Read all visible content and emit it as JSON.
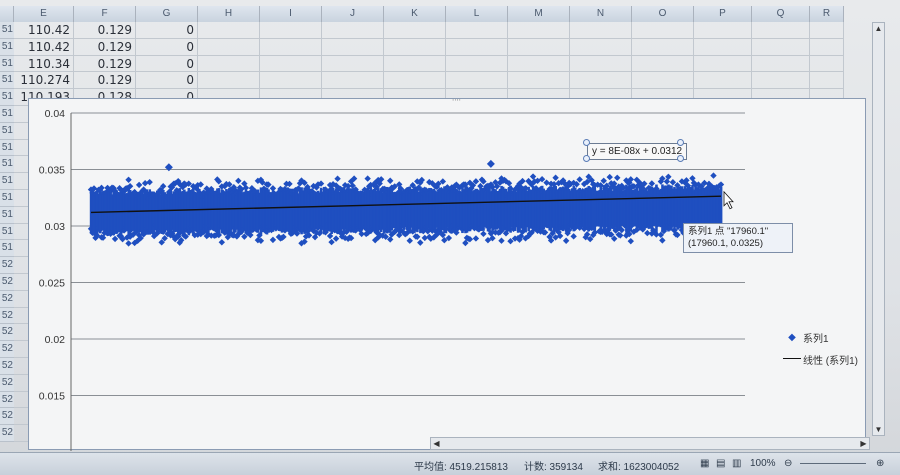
{
  "columns": [
    "E",
    "F",
    "G",
    "H",
    "I",
    "J",
    "K",
    "L",
    "M",
    "N",
    "O",
    "P",
    "Q",
    "R"
  ],
  "row_labels": [
    "51",
    "51",
    "51",
    "51",
    "51",
    "51",
    "51",
    "51",
    "51",
    "51",
    "51",
    "51",
    "51",
    "51",
    "52",
    "52",
    "52",
    "52",
    "52",
    "52",
    "52",
    "52",
    "52",
    "52",
    "52"
  ],
  "rows": [
    {
      "e": "110.42",
      "f": "0.129",
      "g": "0"
    },
    {
      "e": "110.42",
      "f": "0.129",
      "g": "0"
    },
    {
      "e": "110.34",
      "f": "0.129",
      "g": "0"
    },
    {
      "e": "110.274",
      "f": "0.129",
      "g": "0"
    },
    {
      "e": "110.193",
      "f": "0.128",
      "g": "0"
    }
  ],
  "chart_data": {
    "type": "scatter",
    "series": [
      {
        "name": "系列1",
        "marker": "diamond",
        "color": "#1f4fc0",
        "y_center": 0.0312,
        "y_band": [
          0.0285,
          0.0345
        ],
        "outliers": [
          [
            2220,
            0.0352
          ],
          [
            11400,
            0.0355
          ]
        ]
      },
      {
        "name": "线性 (系列1)",
        "type": "trendline",
        "slope": 8e-08,
        "intercept": 0.0312,
        "color": "#111111"
      }
    ],
    "x_range": [
      0,
      17960.1
    ],
    "ylim": [
      0.01,
      0.04
    ],
    "yticks": [
      "0.04",
      "0.035",
      "0.03",
      "0.025",
      "0.02",
      "0.015"
    ],
    "grid": true,
    "legend": "right",
    "trend_label": "y = 8E-08x + 0.0312",
    "tooltip": {
      "line1": "系列1 点 \"17960.1\"",
      "line2": "(17960.1, 0.0325)"
    }
  },
  "status": {
    "average": "平均值: 4519.215813",
    "count": "计数: 359134",
    "sum": "求和: 1623004052",
    "zoom": "100%"
  }
}
